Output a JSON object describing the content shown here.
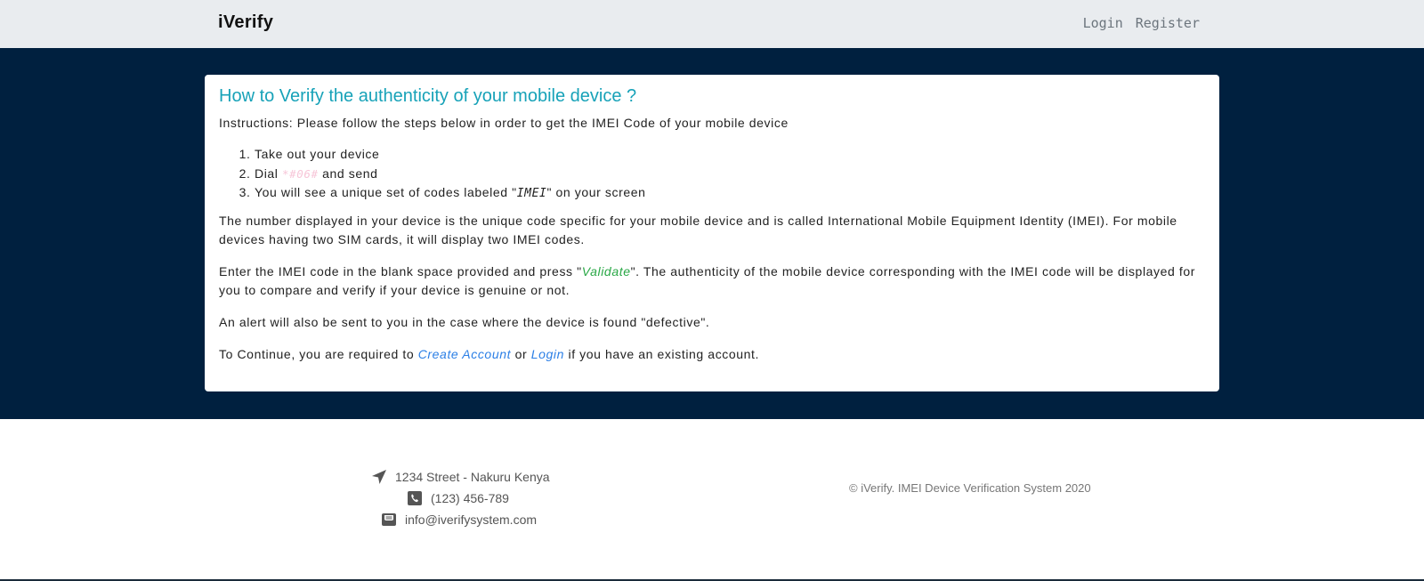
{
  "nav": {
    "brand": "iVerify",
    "links": [
      "Login",
      "Register"
    ]
  },
  "card": {
    "title": "How to Verify the authenticity of your mobile device ?",
    "instructions": "Instructions: Please follow the steps below in order to get the IMEI Code of your mobile device",
    "steps": {
      "s1": "Take out your device",
      "s2_pre": "Dial ",
      "s2_code": "*#06#",
      "s2_post": " and send",
      "s3_pre": "You will see a unique set of codes labeled \"",
      "s3_code": "IMEI",
      "s3_post": "\" on your screen"
    },
    "para1": "The number displayed in your device is the unique code specific for your mobile device and is called International Mobile Equipment Identity (IMEI). For mobile devices having two SIM cards, it will display two IMEI codes.",
    "para2_pre": "Enter the IMEI code in the blank space provided and press \"",
    "para2_validate": "Validate",
    "para2_post": "\". The authenticity of the mobile device corresponding with the IMEI code will be displayed for you to compare and verify if your device is genuine or not.",
    "para3": "An alert will also be sent to you in the case where the device is found \"defective\".",
    "para4_pre": "To Continue, you are required to ",
    "para4_create": "Create Account",
    "para4_mid": " or ",
    "para4_login": "Login",
    "para4_post": " if you have an existing account."
  },
  "footer": {
    "address": "1234 Street - Nakuru Kenya",
    "phone": "(123) 456-789",
    "email": "info@iverifysystem.com",
    "copyright": "© iVerify. IMEI Device Verification System 2020",
    "icons": [
      "location-arrow-icon",
      "phone-icon",
      "envelope-open-icon"
    ]
  },
  "colors": {
    "hero_bg": "#00203f",
    "title": "#17a2b8",
    "link": "#2b7fe6",
    "validate": "#28a745"
  }
}
